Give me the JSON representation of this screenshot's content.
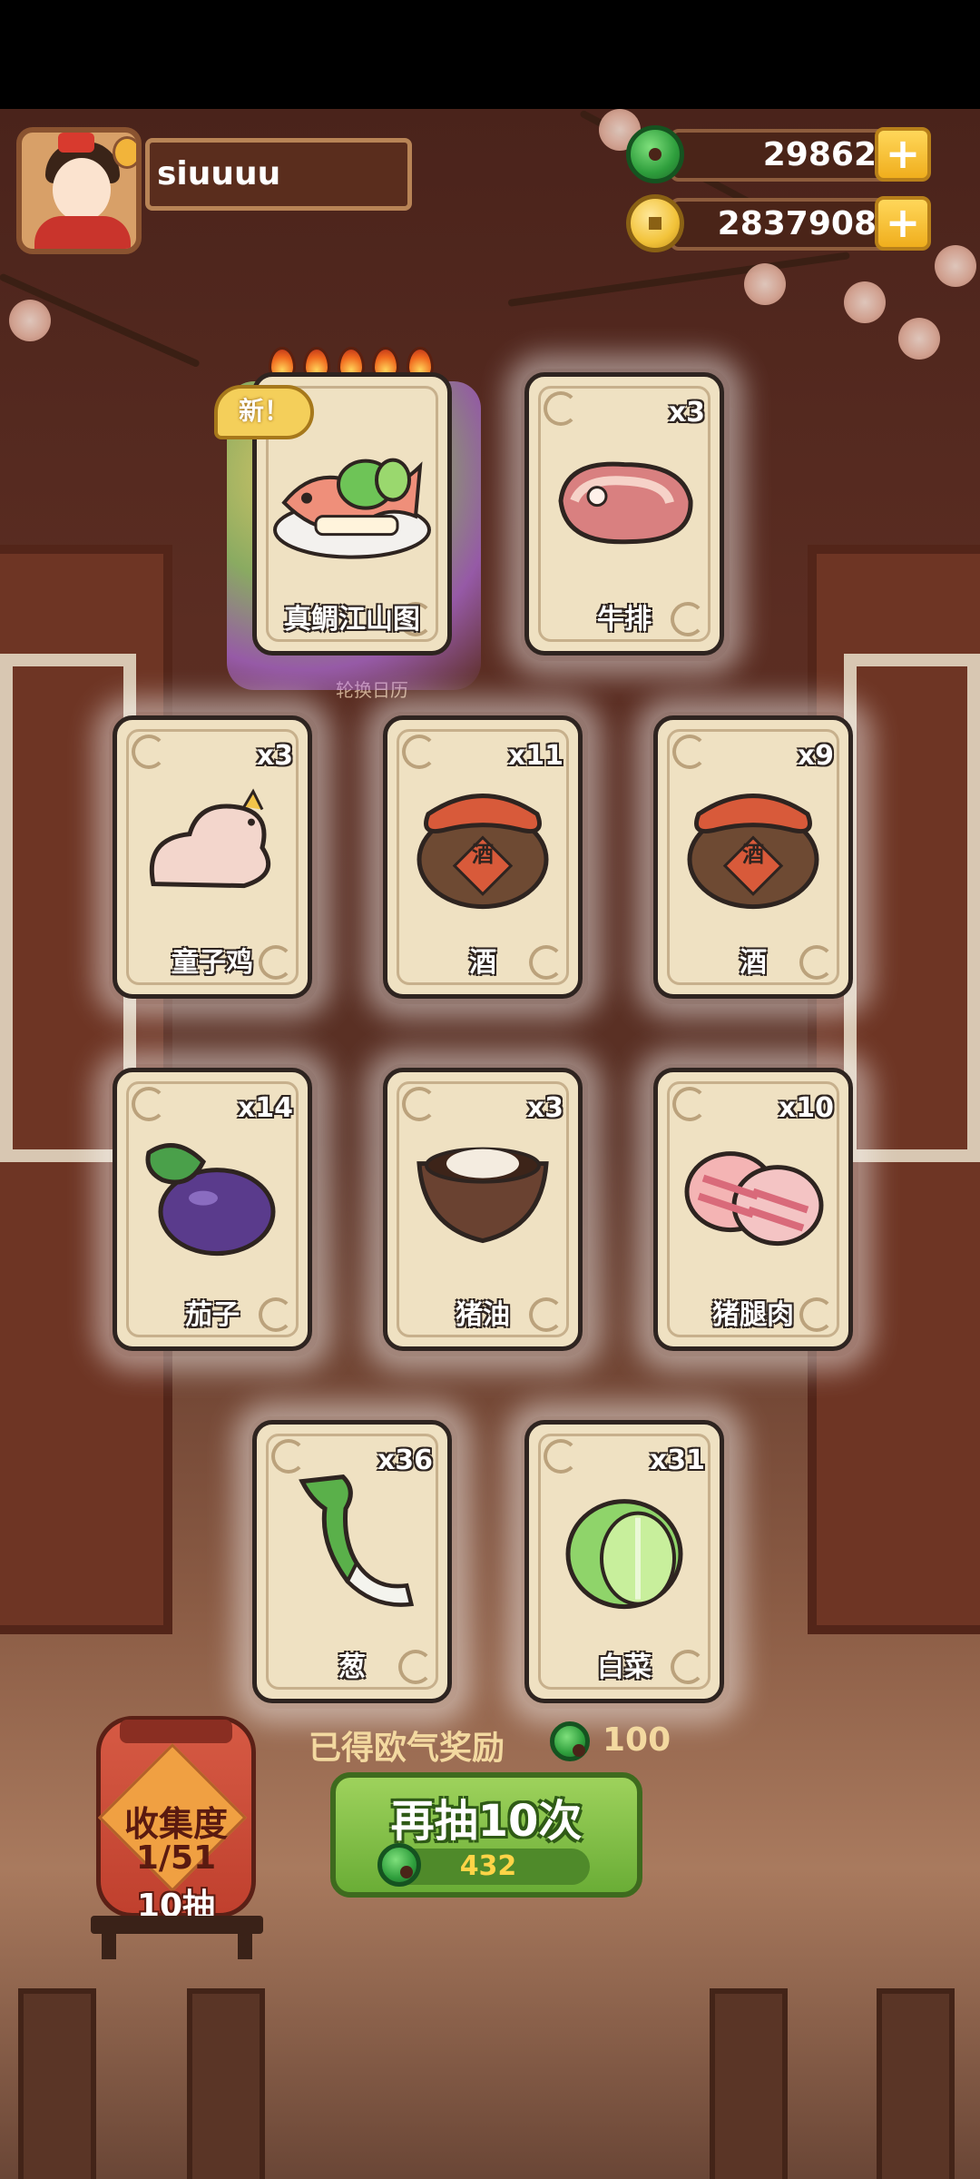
{
  "player": {
    "name": "siuuuu"
  },
  "resources": {
    "jade": {
      "icon": "jade-icon",
      "value": "29862"
    },
    "coins": {
      "icon": "coin-icon",
      "value": "2837908"
    }
  },
  "cards": [
    {
      "name": "真鲷江山图",
      "qty": "",
      "is_new": true,
      "new_label": "新！",
      "rarity_flames": 5,
      "icon": "fish-platter-icon"
    },
    {
      "name": "牛排",
      "qty": "x3",
      "icon": "steak-icon"
    },
    {
      "name": "童子鸡",
      "qty": "x3",
      "icon": "chicken-icon"
    },
    {
      "name": "酒",
      "qty": "x11",
      "icon": "wine-jar-icon",
      "jar_text": "酒"
    },
    {
      "name": "酒",
      "qty": "x9",
      "icon": "wine-jar-icon",
      "jar_text": "酒"
    },
    {
      "name": "茄子",
      "qty": "x14",
      "icon": "eggplant-icon"
    },
    {
      "name": "猪油",
      "qty": "x3",
      "icon": "lard-icon"
    },
    {
      "name": "猪腿肉",
      "qty": "x10",
      "icon": "pork-icon"
    },
    {
      "name": "葱",
      "qty": "x36",
      "icon": "scallion-icon"
    },
    {
      "name": "白菜",
      "qty": "x31",
      "icon": "cabbage-icon"
    }
  ],
  "background": {
    "calendar_text": "轮换日历"
  },
  "reward": {
    "label": "已得欧气奖励",
    "value": "100",
    "icon": "jade-icon"
  },
  "collection": {
    "label": "收集度",
    "progress": "1/51",
    "draws": "10抽"
  },
  "draw_button": {
    "label": "再抽10次",
    "cost": "432",
    "cost_icon": "jade-icon"
  },
  "colors": {
    "accent_green": "#6aad36",
    "gold": "#f0ae1d",
    "card_bg": "#efe1c2"
  }
}
